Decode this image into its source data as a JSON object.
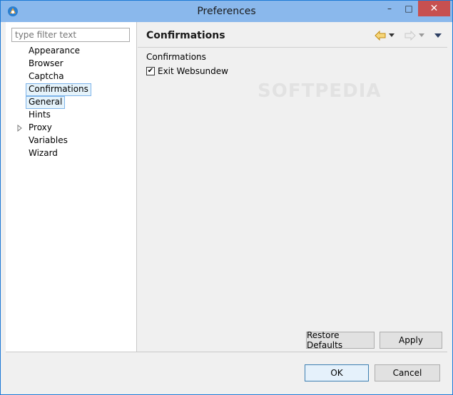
{
  "window": {
    "title": "Preferences",
    "minimize_label": "–",
    "maximize_label": "□",
    "close_label": "✕"
  },
  "filter": {
    "placeholder": "type filter text",
    "value": ""
  },
  "tree": {
    "items": [
      {
        "label": "Appearance"
      },
      {
        "label": "Browser"
      },
      {
        "label": "Captcha"
      },
      {
        "label": "Confirmations"
      },
      {
        "label": "General"
      },
      {
        "label": "Hints"
      },
      {
        "label": "Proxy"
      },
      {
        "label": "Variables"
      },
      {
        "label": "Wizard"
      }
    ]
  },
  "page": {
    "title": "Confirmations",
    "section_label": "Confirmations",
    "checkbox_label": "Exit Websundew",
    "checkbox_checked": true,
    "checkmark": "✔",
    "watermark": "SOFTPEDIA"
  },
  "buttons": {
    "restore_defaults": "Restore Defaults",
    "apply": "Apply",
    "ok": "OK",
    "cancel": "Cancel"
  },
  "colors": {
    "titlebar": "#8ab8ec",
    "selection_border": "#7eb4ea",
    "selection_fill": "#e5f3fb",
    "close_button": "#c75050",
    "nav_arrow_active": "#e0a92a",
    "nav_arrow_disabled": "#c8c8c8"
  }
}
